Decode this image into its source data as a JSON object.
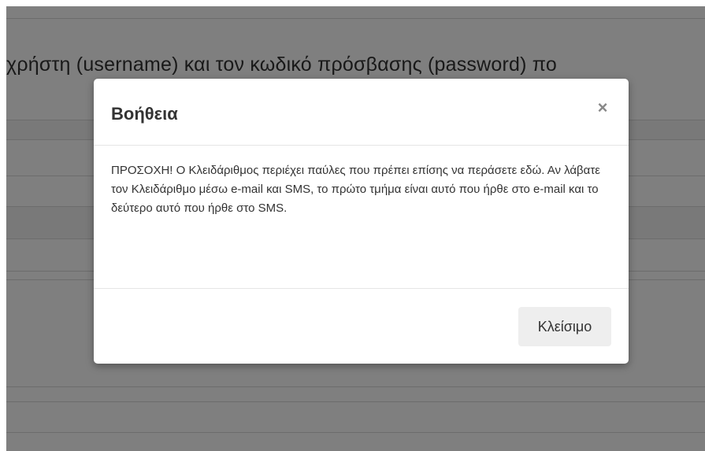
{
  "background": {
    "heading": "χρήστη (username) και τον κωδικό πρόσβασης (password) πο"
  },
  "modal": {
    "title": "Βοήθεια",
    "close_icon": "×",
    "body_text": "ΠΡΟΣΟΧΗ! Ο Κλειδάριθμος περιέχει παύλες που πρέπει επίσης να περάσετε εδώ. Αν λάβατε τον Κλειδάριθμο μέσω e-mail και SMS, το πρώτο τμήμα είναι αυτό που ήρθε στο e-mail και το δεύτερο αυτό που ήρθε στο SMS.",
    "close_button_label": "Κλείσιμο"
  },
  "colors": {
    "backdrop": "rgba(0,0,0,0.5)",
    "button_bg": "#eeeeee",
    "text": "#333333"
  }
}
